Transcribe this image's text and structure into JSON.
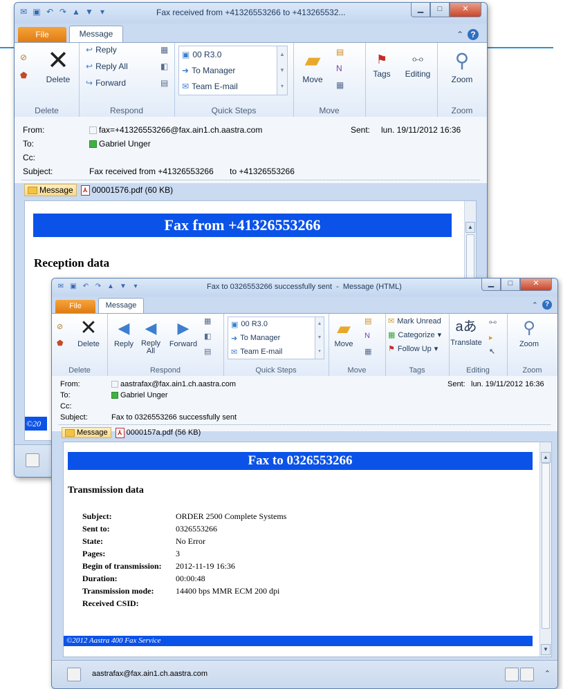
{
  "back_window": {
    "title": "Fax received from +41326553266 to +413265532...",
    "tabs": {
      "file": "File",
      "message": "Message"
    },
    "ribbon": {
      "delete_group": {
        "button": "Delete",
        "label": "Delete"
      },
      "respond_group": {
        "reply": "Reply",
        "reply_all": "Reply All",
        "forward": "Forward",
        "label": "Respond"
      },
      "quick_steps": {
        "items": [
          "00 R3.0",
          "To Manager",
          "Team E-mail"
        ],
        "label": "Quick Steps"
      },
      "move_group": {
        "button": "Move",
        "label": "Move"
      },
      "tags": "Tags",
      "editing": "Editing",
      "zoom": {
        "button": "Zoom",
        "label": "Zoom"
      }
    },
    "header": {
      "from_label": "From:",
      "from_value": "fax=+41326553266@fax.ain1.ch.aastra.com",
      "to_label": "To:",
      "to_value": "Gabriel Unger",
      "cc_label": "Cc:",
      "subject_label": "Subject:",
      "subject_value": "Fax received from +41326553266       to +41326553266",
      "sent_label": "Sent:",
      "sent_value": "lun. 19/11/2012 16:36"
    },
    "attachments": {
      "message": "Message",
      "file": "00001576.pdf (60 KB)"
    },
    "body": {
      "banner": "Fax from +41326553266",
      "section": "Reception data",
      "footer_stub": "©20"
    }
  },
  "front_window": {
    "title": "Fax to 0326553266 successfully sent  -  Message (HTML)",
    "tabs": {
      "file": "File",
      "message": "Message"
    },
    "ribbon": {
      "delete_group": {
        "button": "Delete",
        "label": "Delete"
      },
      "respond_group": {
        "reply": "Reply",
        "reply_all": "Reply All",
        "forward": "Forward",
        "label": "Respond"
      },
      "quick_steps": {
        "items": [
          "00 R3.0",
          "To Manager",
          "Team E-mail"
        ],
        "label": "Quick Steps"
      },
      "move_group": {
        "button": "Move",
        "label": "Move"
      },
      "tags_group": {
        "mark_unread": "Mark Unread",
        "categorize": "Categorize",
        "follow_up": "Follow Up",
        "label": "Tags"
      },
      "editing_group": {
        "translate": "Translate",
        "label": "Editing"
      },
      "zoom_group": {
        "button": "Zoom",
        "label": "Zoom"
      }
    },
    "header": {
      "from_label": "From:",
      "from_value": "aastrafax@fax.ain1.ch.aastra.com",
      "to_label": "To:",
      "to_value": "Gabriel Unger",
      "cc_label": "Cc:",
      "subject_label": "Subject:",
      "subject_value": "Fax to 0326553266 successfully sent",
      "sent_label": "Sent:",
      "sent_value": "lun. 19/11/2012 16:36"
    },
    "attachments": {
      "message": "Message",
      "file": "0000157a.pdf (56 KB)"
    },
    "body": {
      "banner": "Fax to 0326553266",
      "section": "Transmission data",
      "rows": [
        {
          "key": "Subject:",
          "value": "ORDER 2500 Complete Systems"
        },
        {
          "key": "Sent to:",
          "value": "0326553266"
        },
        {
          "key": "State:",
          "value": "No Error"
        },
        {
          "key": "Pages:",
          "value": "3"
        },
        {
          "key": "Begin of transmission:",
          "value": "2012-11-19 16:36"
        },
        {
          "key": "Duration:",
          "value": "00:00:48"
        },
        {
          "key": "Transmission mode:",
          "value": "14400 bps MMR ECM 200 dpi"
        },
        {
          "key": "Received CSID:",
          "value": ""
        }
      ],
      "footer": "©2012 Aastra 400 Fax Service"
    },
    "people_pane": {
      "contact": "aastrafax@fax.ain1.ch.aastra.com"
    }
  }
}
